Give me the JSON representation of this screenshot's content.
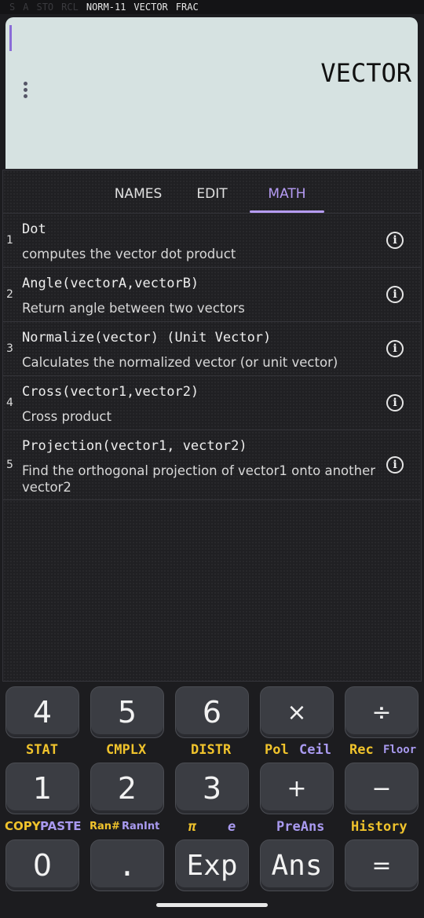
{
  "status_bar": {
    "dim_items": [
      "S",
      "A",
      "STO",
      "RCL"
    ],
    "active_items": [
      "NORM-11",
      "VECTOR",
      "FRAC"
    ]
  },
  "display": {
    "text": "VECTOR"
  },
  "tabs": [
    {
      "label": "NAMES",
      "active": false
    },
    {
      "label": "EDIT",
      "active": false
    },
    {
      "label": "MATH",
      "active": true
    }
  ],
  "functions": [
    {
      "num": "1",
      "title": "Dot",
      "desc": "computes the vector dot product"
    },
    {
      "num": "2",
      "title": "Angle(vectorA,vectorB)",
      "desc": "Return angle between two vectors"
    },
    {
      "num": "3",
      "title": "Normalize(vector) (Unit Vector)",
      "desc": "Calculates the normalized vector (or unit vector)"
    },
    {
      "num": "4",
      "title": "Cross(vector1,vector2)",
      "desc": "Cross product"
    },
    {
      "num": "5",
      "title": "Projection(vector1, vector2)",
      "desc": "Find the orthogonal projection of vector1 onto another vector2"
    }
  ],
  "keys": {
    "row1": [
      "4",
      "5",
      "6",
      "×",
      "÷"
    ],
    "row2": [
      "1",
      "2",
      "3",
      "+",
      "−"
    ],
    "row3": [
      "0",
      ".",
      "Exp",
      "Ans",
      "="
    ]
  },
  "alt_labels": {
    "row1": {
      "stat": "STAT",
      "cmplx": "CMPLX",
      "distr": "DISTR",
      "pol": "Pol",
      "ceil": "Ceil",
      "rec": "Rec",
      "floor": "Floor"
    },
    "row2": {
      "copy": "COPY",
      "paste": "PASTE",
      "ran_hash": "Ran#",
      "ranint": "RanInt",
      "pi": "π",
      "e": "e",
      "preans": "PreAns",
      "history": "History"
    }
  },
  "colors": {
    "accent": "#b69cf5",
    "shift_yellow": "#f0c32c",
    "alpha_blue": "#a99af0",
    "display_bg": "#d6e2e1"
  }
}
